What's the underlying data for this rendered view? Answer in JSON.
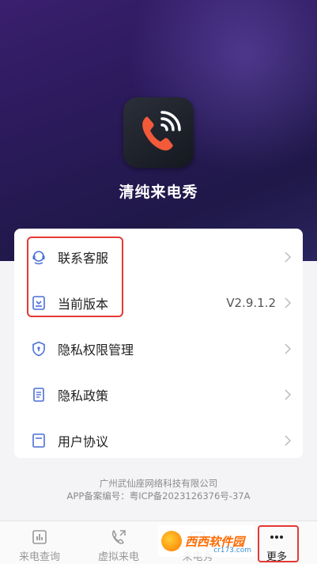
{
  "app": {
    "name": "清纯来电秀"
  },
  "menu": {
    "items": [
      {
        "label": "联系客服",
        "value": ""
      },
      {
        "label": "当前版本",
        "value": "V2.9.1.2"
      },
      {
        "label": "隐私权限管理",
        "value": ""
      },
      {
        "label": "隐私政策",
        "value": ""
      },
      {
        "label": "用户协议",
        "value": ""
      }
    ]
  },
  "footer": {
    "company": "广州武仙座网络科技有限公司",
    "icp": "APP备案编号：粤ICP备2023126376号-37A"
  },
  "tabs": [
    {
      "label": "来电查询",
      "icon": "chart-icon"
    },
    {
      "label": "虚拟来电",
      "icon": "phone-call-icon"
    },
    {
      "label": "来电秀",
      "icon": "video-icon"
    },
    {
      "label": "更多",
      "icon": "more-icon"
    }
  ],
  "watermark": {
    "main": "西西软件园",
    "sub": "cr173.com"
  },
  "colors": {
    "accent_red": "#e53935",
    "hero_purple": "#2a1a5a",
    "icon_blue": "#4a6fd6"
  }
}
